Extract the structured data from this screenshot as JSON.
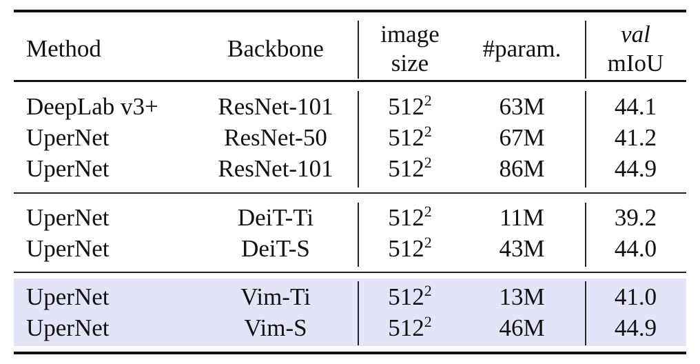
{
  "table": {
    "headers": {
      "method": "Method",
      "backbone": "Backbone",
      "image_size_line1": "image",
      "image_size_line2": "size",
      "params": "#param.",
      "miou_line1": "val",
      "miou_line2": "mIoU"
    },
    "highlight_color": "#e4e4f8",
    "groups": [
      {
        "highlighted": false,
        "rows": [
          {
            "method": "DeepLab v3+",
            "backbone": "ResNet-101",
            "size_base": "512",
            "size_exp": "2",
            "params": "63M",
            "miou": "44.1"
          },
          {
            "method": "UperNet",
            "backbone": "ResNet-50",
            "size_base": "512",
            "size_exp": "2",
            "params": "67M",
            "miou": "41.2"
          },
          {
            "method": "UperNet",
            "backbone": "ResNet-101",
            "size_base": "512",
            "size_exp": "2",
            "params": "86M",
            "miou": "44.9"
          }
        ]
      },
      {
        "highlighted": false,
        "rows": [
          {
            "method": "UperNet",
            "backbone": "DeiT-Ti",
            "size_base": "512",
            "size_exp": "2",
            "params": "11M",
            "miou": "39.2"
          },
          {
            "method": "UperNet",
            "backbone": "DeiT-S",
            "size_base": "512",
            "size_exp": "2",
            "params": "43M",
            "miou": "44.0"
          }
        ]
      },
      {
        "highlighted": true,
        "rows": [
          {
            "method": "UperNet",
            "backbone": "Vim-Ti",
            "size_base": "512",
            "size_exp": "2",
            "params": "13M",
            "miou": "41.0"
          },
          {
            "method": "UperNet",
            "backbone": "Vim-S",
            "size_base": "512",
            "size_exp": "2",
            "params": "46M",
            "miou": "44.9"
          }
        ]
      }
    ]
  }
}
